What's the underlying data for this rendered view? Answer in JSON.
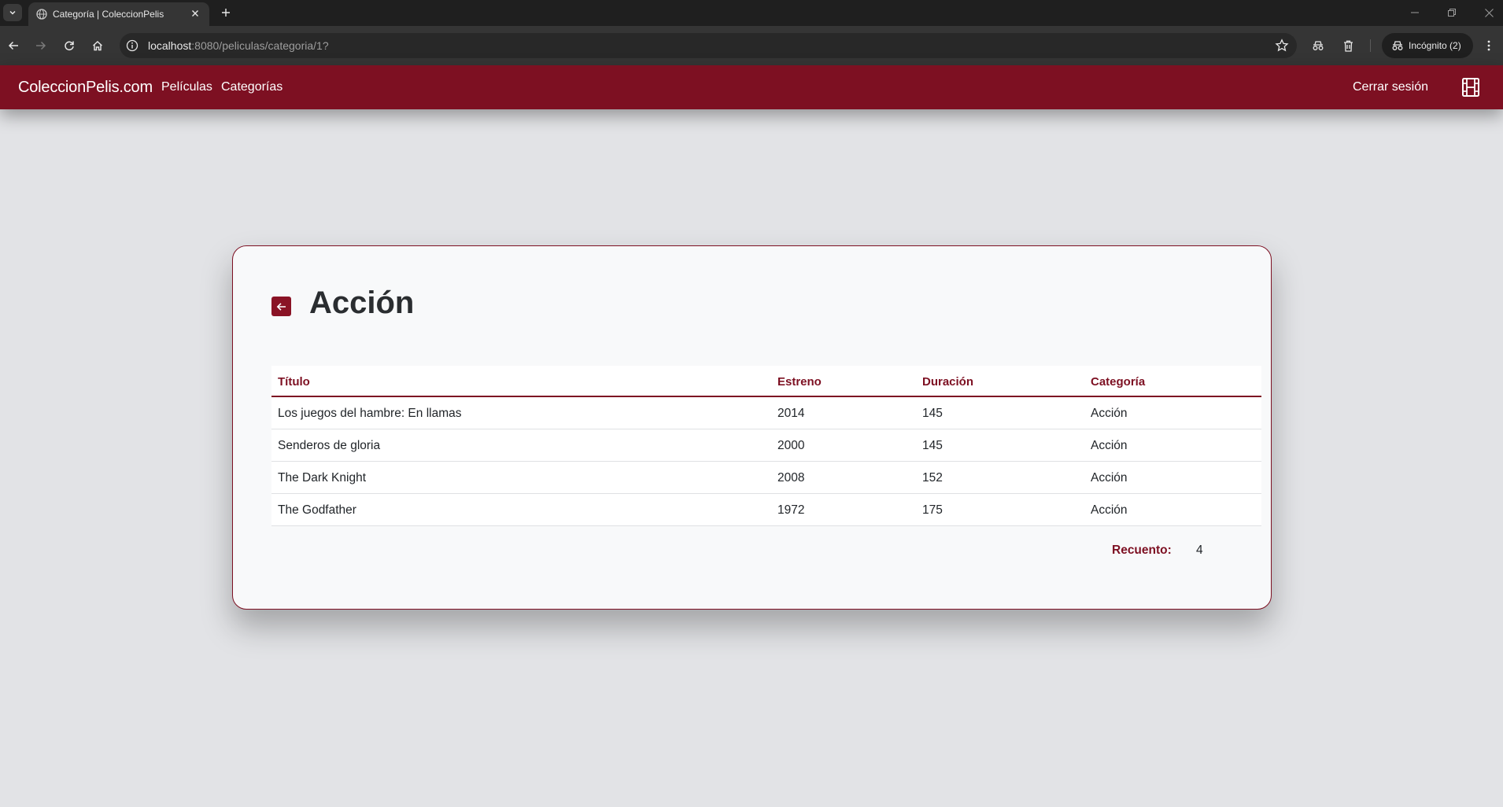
{
  "browser": {
    "tab_title": "Categoría | ColeccionPelis",
    "url_host": "localhost",
    "url_rest": ":8080/peliculas/categoria/1?",
    "incognito_label": "Incógnito (2)"
  },
  "navbar": {
    "brand": "ColeccionPelis.com",
    "links": [
      {
        "label": "Películas"
      },
      {
        "label": "Categorías"
      }
    ],
    "logout": "Cerrar sesión"
  },
  "page": {
    "title": "Acción"
  },
  "table": {
    "headers": [
      "Título",
      "Estreno",
      "Duración",
      "Categoría"
    ],
    "rows": [
      [
        "Los juegos del hambre: En llamas",
        "2014",
        "145",
        "Acción"
      ],
      [
        "Senderos de gloria",
        "2000",
        "145",
        "Acción"
      ],
      [
        "The Dark Knight",
        "2008",
        "152",
        "Acción"
      ],
      [
        "The Godfather",
        "1972",
        "175",
        "Acción"
      ]
    ]
  },
  "summary": {
    "label": "Recuento:",
    "value": "4"
  },
  "colors": {
    "brand": "#7d1022",
    "background": "#e2e3e6",
    "card": "#f8f9fa"
  }
}
